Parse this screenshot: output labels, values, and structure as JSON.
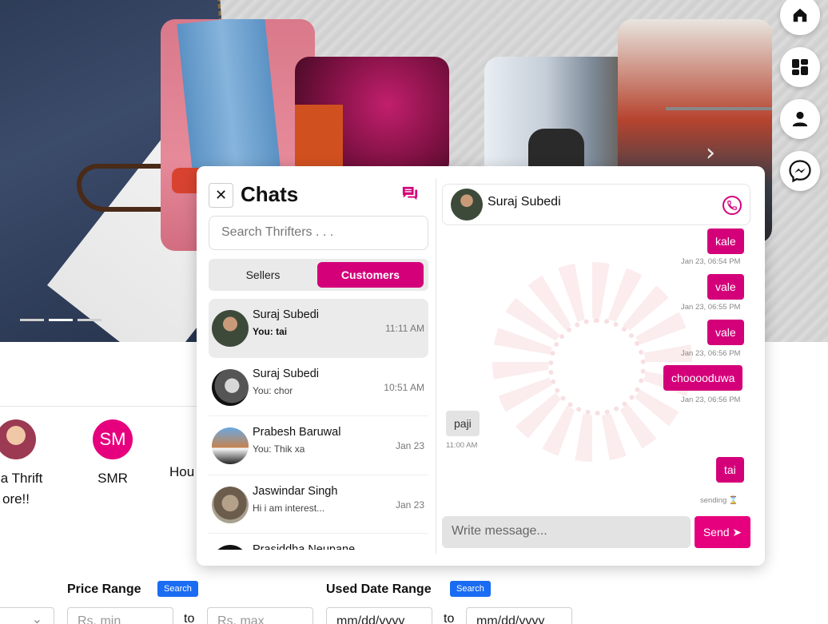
{
  "hero": {
    "carousel_dots": 3,
    "active_dot": 2
  },
  "side_nav": [
    {
      "icon": "home-icon"
    },
    {
      "icon": "dashboard-icon"
    },
    {
      "icon": "user-icon"
    },
    {
      "icon": "messenger-icon"
    }
  ],
  "stores": [
    {
      "label_line1": "ma Thrift",
      "label_line2": "ore!!"
    },
    {
      "initials": "SM",
      "label": "SMR"
    },
    {
      "label": "Hou"
    }
  ],
  "filters": {
    "price_label": "Price Range",
    "price_search": "Search",
    "min_placeholder": "Rs. min",
    "max_placeholder": "Rs. max",
    "to": "to",
    "date_label": "Used Date Range",
    "date_search": "Search",
    "date_placeholder": "mm/dd/yyyy"
  },
  "chats": {
    "title": "Chats",
    "close": "✕",
    "search_placeholder": "Search Thrifters . . .",
    "tabs": {
      "sellers": "Sellers",
      "customers": "Customers",
      "active": "customers"
    },
    "list": [
      {
        "name": "Suraj Subedi",
        "preview": "You: tai",
        "time": "11:11 AM",
        "active": true
      },
      {
        "name": "Suraj Subedi",
        "preview": "You: chor",
        "time": "10:51 AM"
      },
      {
        "name": "Prabesh Baruwal",
        "preview": "You: Thik xa",
        "time": "Jan 23"
      },
      {
        "name": "Jaswindar Singh",
        "preview": "Hi i am interest...",
        "time": "Jan 23"
      },
      {
        "name": "Prasiddha Neupane",
        "preview": "",
        "time": ""
      }
    ]
  },
  "conversation": {
    "contact": "Suraj Subedi",
    "messages": [
      {
        "text": "kale",
        "time": "Jan 23, 06:54 PM",
        "outgoing": true
      },
      {
        "text": "vale",
        "time": "Jan 23, 06:55 PM",
        "outgoing": true
      },
      {
        "text": "vale",
        "time": "Jan 23, 06:56 PM",
        "outgoing": true
      },
      {
        "text": "chooooduwa",
        "time": "Jan 23, 06:56 PM",
        "outgoing": true
      },
      {
        "text": "paji",
        "time": "11:00 AM",
        "outgoing": false
      },
      {
        "text": "tai",
        "time": "sending ⌛",
        "outgoing": true
      }
    ],
    "composer_placeholder": "Write message...",
    "send_label": "Send ➤"
  },
  "colors": {
    "accent": "#d4007a",
    "send": "#e6007e",
    "blue": "#1a6cf2"
  }
}
